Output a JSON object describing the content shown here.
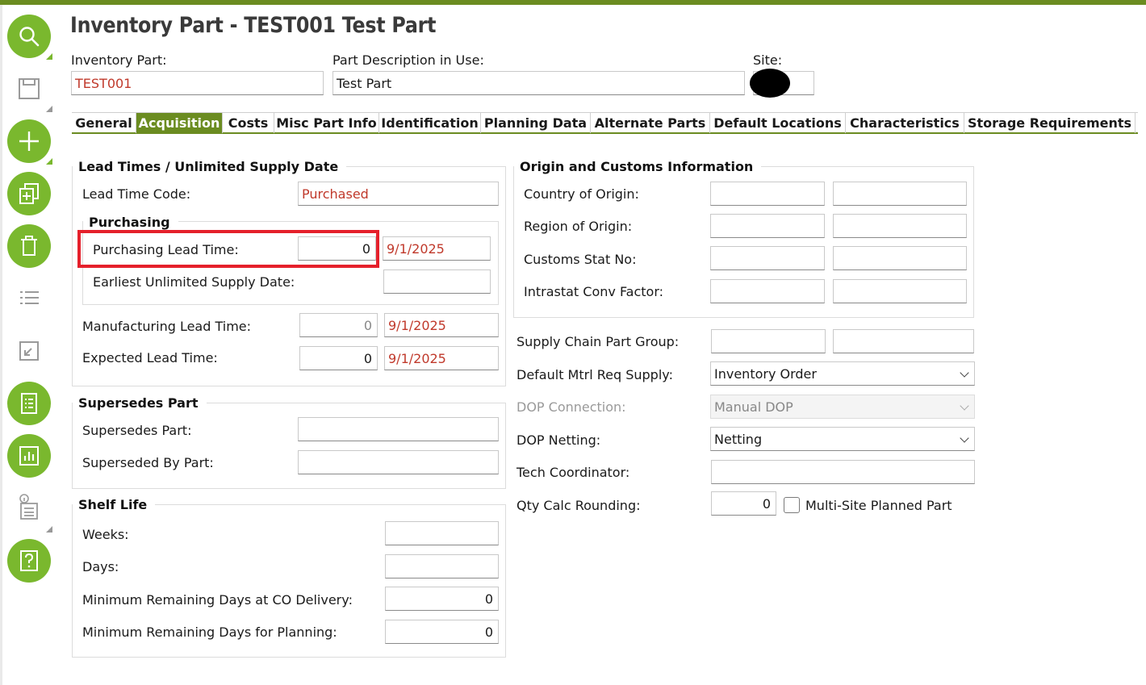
{
  "header": {
    "title": "Inventory Part - TEST001 Test Part",
    "inventory_part_label": "Inventory Part:",
    "inventory_part_value": "TEST001",
    "description_label": "Part Description in Use:",
    "description_value": "Test Part",
    "site_label": "Site:",
    "site_value": ""
  },
  "tabs": [
    {
      "label": "General"
    },
    {
      "label": "Acquisition",
      "active": true
    },
    {
      "label": "Costs"
    },
    {
      "label": "Misc Part Info"
    },
    {
      "label": "Identification"
    },
    {
      "label": "Planning Data"
    },
    {
      "label": "Alternate Parts"
    },
    {
      "label": "Default Locations"
    },
    {
      "label": "Characteristics"
    },
    {
      "label": "Storage Requirements"
    }
  ],
  "lead_times": {
    "title": "Lead Times / Unlimited Supply Date",
    "lead_time_code_label": "Lead Time Code:",
    "lead_time_code_value": "Purchased",
    "purchasing": {
      "title": "Purchasing",
      "purchasing_lead_time_label": "Purchasing Lead Time:",
      "purchasing_lead_time_value": "0",
      "purchasing_date": "9/1/2025",
      "earliest_unlimited_label": "Earliest Unlimited Supply Date:",
      "earliest_unlimited_value": ""
    },
    "manufacturing_lead_time_label": "Manufacturing Lead Time:",
    "manufacturing_lead_time_value": "0",
    "manufacturing_date": "9/1/2025",
    "expected_lead_time_label": "Expected Lead Time:",
    "expected_lead_time_value": "0",
    "expected_date": "9/1/2025"
  },
  "supersedes": {
    "title": "Supersedes Part",
    "supersedes_label": "Supersedes Part:",
    "supersedes_value": "",
    "superseded_by_label": "Superseded By Part:",
    "superseded_by_value": ""
  },
  "shelf_life": {
    "title": "Shelf Life",
    "weeks_label": "Weeks:",
    "weeks_value": "",
    "days_label": "Days:",
    "days_value": "",
    "min_co_label": "Minimum Remaining Days at CO Delivery:",
    "min_co_value": "0",
    "min_planning_label": "Minimum Remaining Days for Planning:",
    "min_planning_value": "0"
  },
  "origin": {
    "title": "Origin and Customs Information",
    "country_label": "Country of Origin:",
    "region_label": "Region of Origin:",
    "customs_label": "Customs Stat No:",
    "intrastat_label": "Intrastat Conv Factor:"
  },
  "supply": {
    "supply_chain_label": "Supply Chain Part Group:",
    "mtrl_req_label": "Default Mtrl Req Supply:",
    "mtrl_req_value": "Inventory Order",
    "dop_connection_label": "DOP Connection:",
    "dop_connection_value": "Manual DOP",
    "dop_netting_label": "DOP Netting:",
    "dop_netting_value": "Netting",
    "tech_coordinator_label": "Tech Coordinator:",
    "tech_coordinator_value": "",
    "qty_calc_label": "Qty Calc Rounding:",
    "qty_calc_value": "0",
    "multi_site_label": "Multi-Site Planned Part"
  },
  "colors": {
    "accent": "#6b8c21",
    "button": "#7ab82e",
    "highlight": "#e5202b",
    "value_red": "#c0392b"
  },
  "toolbar_icons": [
    "search-icon",
    "save-icon",
    "add-icon",
    "duplicate-icon",
    "delete-icon",
    "list-icon",
    "expand-icon",
    "report-icon",
    "chart-icon",
    "info-icon",
    "help-icon"
  ]
}
